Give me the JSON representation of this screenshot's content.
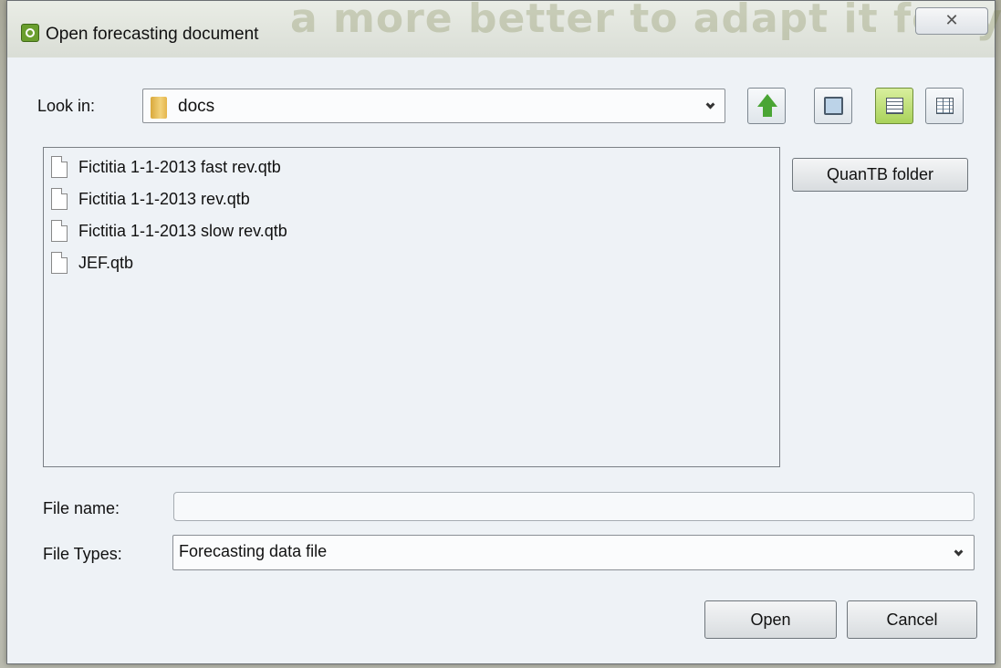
{
  "window": {
    "title": "Open forecasting document",
    "background_text": "a more better to adapt it for your location",
    "close_glyph": "✕"
  },
  "look_in": {
    "label": "Look in:",
    "value": "docs"
  },
  "toolbar": {
    "up_icon": "up-arrow-icon",
    "new_folder_icon": "new-folder-icon",
    "list_view_icon": "list-view-icon",
    "details_view_icon": "details-view-icon"
  },
  "files": [
    {
      "name": "Fictitia 1-1-2013 fast rev.qtb"
    },
    {
      "name": "Fictitia 1-1-2013 rev.qtb"
    },
    {
      "name": "Fictitia 1-1-2013 slow rev.qtb"
    },
    {
      "name": "JEF.qtb"
    }
  ],
  "side_button": {
    "label": "QuanTB folder"
  },
  "file_name": {
    "label": "File name:",
    "value": ""
  },
  "file_types": {
    "label": "File Types:",
    "value": "Forecasting data file"
  },
  "buttons": {
    "open": "Open",
    "cancel": "Cancel"
  },
  "colors": {
    "accent_green": "#a9d25a",
    "up_arrow": "#4aa534"
  }
}
